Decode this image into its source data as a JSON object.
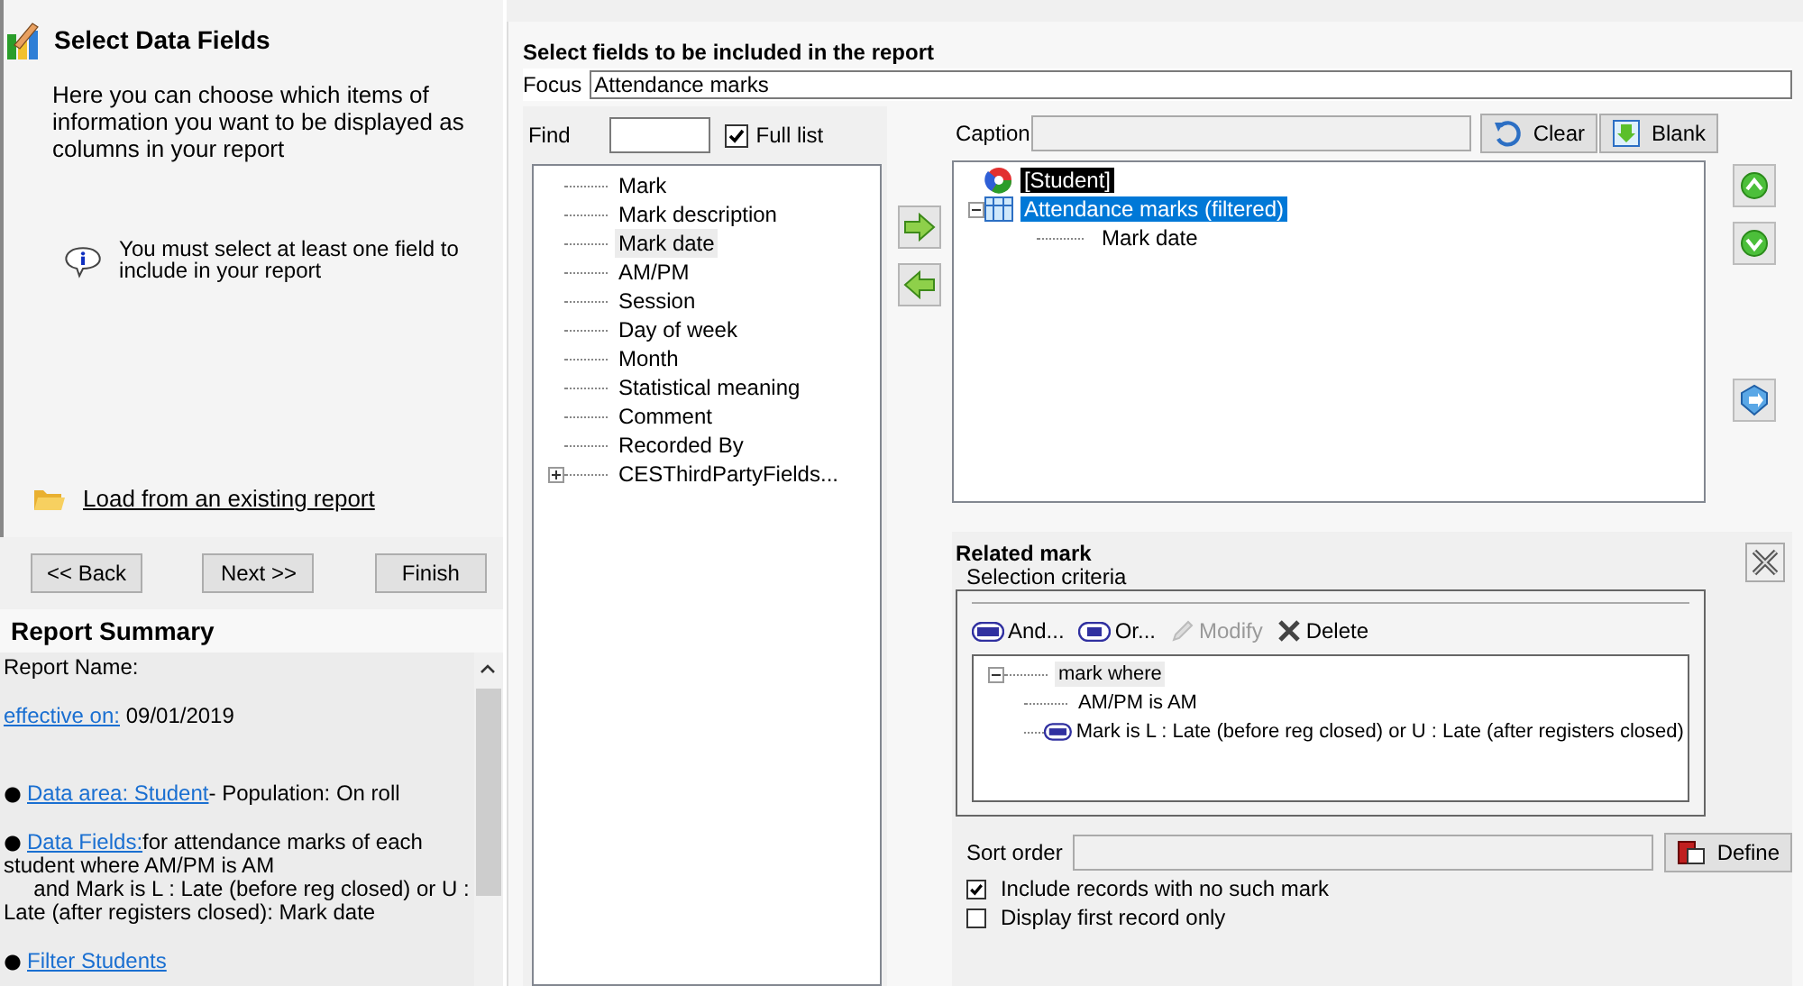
{
  "wizard": {
    "title": "Select Data Fields",
    "description": "Here you can choose which items of information you want to be displayed as columns in your report",
    "info": "You must select at least one field to include in your report",
    "load_link": "Load from an existing report"
  },
  "nav_buttons": [
    "<< Back",
    "Next >>",
    "Finish"
  ],
  "summary": {
    "title": "Report Summary",
    "report_name_label": "Report Name:",
    "effective_link": "effective on:",
    "effective_date": "09/01/2019",
    "items": [
      {
        "link": "Data area: Student",
        "text": "- Population: On roll"
      },
      {
        "link": "Data Fields:",
        "text": "for attendance marks of each student where AM/PM is AM\n     and Mark is L : Late (before reg closed) or U : Late (after registers closed): Mark date"
      },
      {
        "link": "Filter Students"
      }
    ]
  },
  "fields_panel": {
    "title": "Select fields to be included in the report",
    "focus_label": "Focus",
    "focus_value": "Attendance marks",
    "find_label": "Find",
    "full_list": {
      "label": "Full list",
      "checked": true
    },
    "available_fields": [
      {
        "label": "Mark",
        "kind": "field",
        "selected": false
      },
      {
        "label": "Mark description",
        "kind": "field",
        "selected": false
      },
      {
        "label": "Mark date",
        "kind": "field",
        "selected": true
      },
      {
        "label": "AM/PM",
        "kind": "field",
        "selected": false
      },
      {
        "label": "Session",
        "kind": "field",
        "selected": false
      },
      {
        "label": "Day of week",
        "kind": "field",
        "selected": false
      },
      {
        "label": "Month",
        "kind": "field",
        "selected": false
      },
      {
        "label": "Statistical meaning",
        "kind": "field",
        "selected": false
      },
      {
        "label": "Comment",
        "kind": "field",
        "selected": false
      },
      {
        "label": "Recorded By",
        "kind": "field",
        "selected": false
      },
      {
        "label": "CESThirdPartyFields...",
        "kind": "folder",
        "selected": false,
        "expanded": false
      }
    ],
    "caption_label": "Caption",
    "clear_button": "Clear",
    "blank_button": "Blank",
    "selected_tree": [
      {
        "label": "[Student]",
        "kind": "entity",
        "selected": false,
        "focused": true
      },
      {
        "label": "Attendance marks (filtered)",
        "kind": "table",
        "selected": true,
        "focused": false,
        "expanded": true,
        "children": [
          {
            "label": "Mark date",
            "selected": false,
            "focused": false
          }
        ]
      }
    ]
  },
  "related_mark": {
    "title": "Related mark",
    "subtitle": "Selection criteria",
    "toolbar": [
      {
        "label": "And...",
        "kind": "and",
        "disabled": false
      },
      {
        "label": "Or...",
        "kind": "or",
        "disabled": false
      },
      {
        "label": "Modify",
        "kind": "modify",
        "disabled": true
      },
      {
        "label": "Delete",
        "kind": "delete",
        "disabled": false
      }
    ],
    "criteria": {
      "label": "mark where",
      "expanded": true,
      "children": [
        {
          "label": "AM/PM is AM",
          "kind": "plain"
        },
        {
          "label": "Mark is L : Late (before reg closed) or U : Late (after registers closed)",
          "kind": "and"
        }
      ]
    },
    "sort_label": "Sort order",
    "define_button": "Define",
    "options": [
      {
        "label": "Include records with no such mark",
        "checked": true
      },
      {
        "label": "Display first record only",
        "checked": false
      }
    ]
  }
}
